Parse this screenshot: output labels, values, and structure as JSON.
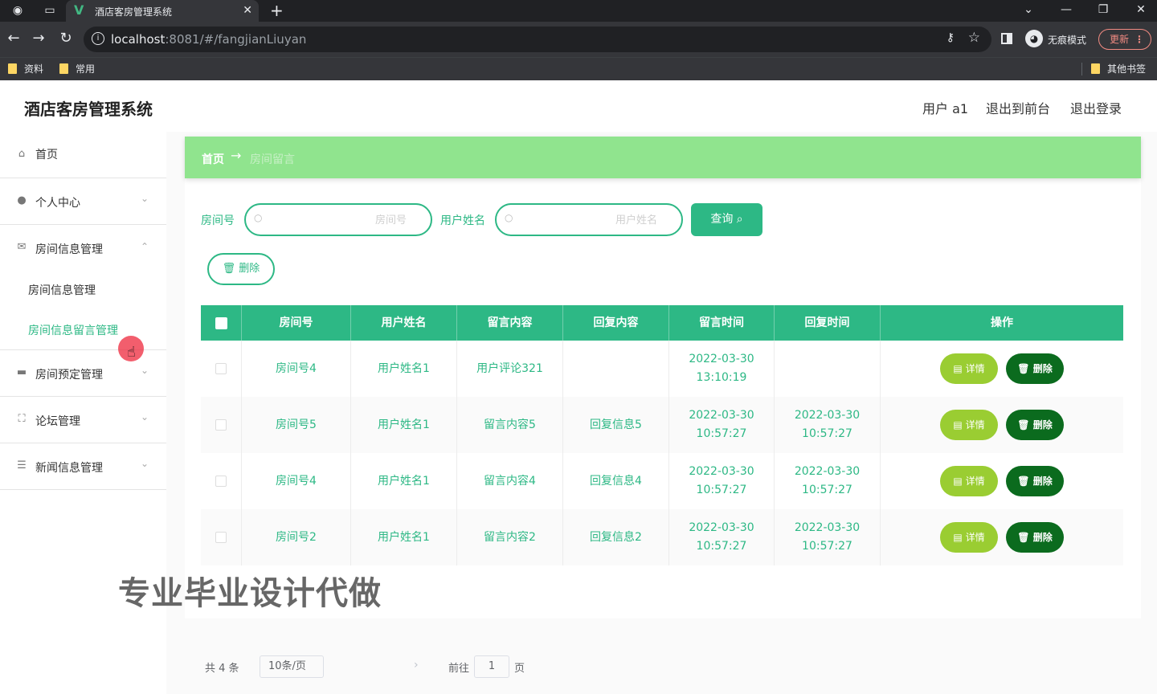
{
  "browser": {
    "tab_title": "酒店客房管理系统",
    "tab_close": "✕",
    "new_tab": "+",
    "url_host": "localhost",
    "url_rest": ":8081/#/fangjianLiuyan",
    "incognito_label": "无痕模式",
    "update_label": "更新",
    "bookmarks": [
      "资料",
      "常用",
      "其他书签"
    ],
    "icons": {
      "back": "←",
      "forward": "→",
      "reload": "↻",
      "key": "⚷",
      "star": "☆",
      "minimize": "—",
      "restore": "❐",
      "close": "✕",
      "tab_list": "⌄"
    }
  },
  "header": {
    "title": "酒店客房管理系统",
    "user": "用户 a1",
    "to_front": "退出到前台",
    "logout": "退出登录"
  },
  "sidebar": {
    "items": [
      {
        "label": "首页",
        "icon": "home-icon",
        "glyph": "⌂"
      },
      {
        "label": "个人中心",
        "icon": "user-icon",
        "glyph": "●"
      },
      {
        "label": "房间信息管理",
        "icon": "message-icon",
        "glyph": "✉",
        "expanded": true
      },
      {
        "label": "房间预定管理",
        "icon": "calendar-icon",
        "glyph": "▬"
      },
      {
        "label": "论坛管理",
        "icon": "fullscreen-icon",
        "glyph": "⛶"
      },
      {
        "label": "新闻信息管理",
        "icon": "sliders-icon",
        "glyph": "☰"
      }
    ],
    "sub_items": [
      "房间信息管理",
      "房间信息留言管理"
    ],
    "active_sub": "房间信息留言管理"
  },
  "breadcrumb": {
    "home": "首页",
    "arrow": "→",
    "current": "房间留言"
  },
  "search": {
    "room_label": "房间号",
    "room_placeholder": "房间号",
    "user_label": "用户姓名",
    "user_placeholder": "用户姓名",
    "query_button": "查询 ⌕",
    "batch_delete": "🗑 删除"
  },
  "table": {
    "columns": [
      "房间号",
      "用户姓名",
      "留言内容",
      "回复内容",
      "留言时间",
      "回复时间",
      "操作"
    ],
    "detail_label": "详情",
    "delete_label": "删除",
    "rows": [
      {
        "room": "房间号4",
        "user": "用户姓名1",
        "content": "用户评论321",
        "reply": "",
        "msg_time": "2022-03-30 13:10:19",
        "reply_time": ""
      },
      {
        "room": "房间号5",
        "user": "用户姓名1",
        "content": "留言内容5",
        "reply": "回复信息5",
        "msg_time": "2022-03-30 10:57:27",
        "reply_time": "2022-03-30 10:57:27"
      },
      {
        "room": "房间号4",
        "user": "用户姓名1",
        "content": "留言内容4",
        "reply": "回复信息4",
        "msg_time": "2022-03-30 10:57:27",
        "reply_time": "2022-03-30 10:57:27"
      },
      {
        "room": "房间号2",
        "user": "用户姓名1",
        "content": "留言内容2",
        "reply": "回复信息2",
        "msg_time": "2022-03-30 10:57:27",
        "reply_time": "2022-03-30 10:57:27"
      }
    ]
  },
  "pagination": {
    "total": "共 4 条",
    "page_size": "10条/页",
    "next": "›",
    "goto_label": "前往",
    "current_page": "1",
    "page_suffix": "页"
  },
  "watermark": "专业毕业设计代做",
  "colors": {
    "primary": "#2db885",
    "breadcrumb_bg": "#90e48e",
    "detail_btn": "#9acd32",
    "delete_btn": "#0b6b1e"
  }
}
